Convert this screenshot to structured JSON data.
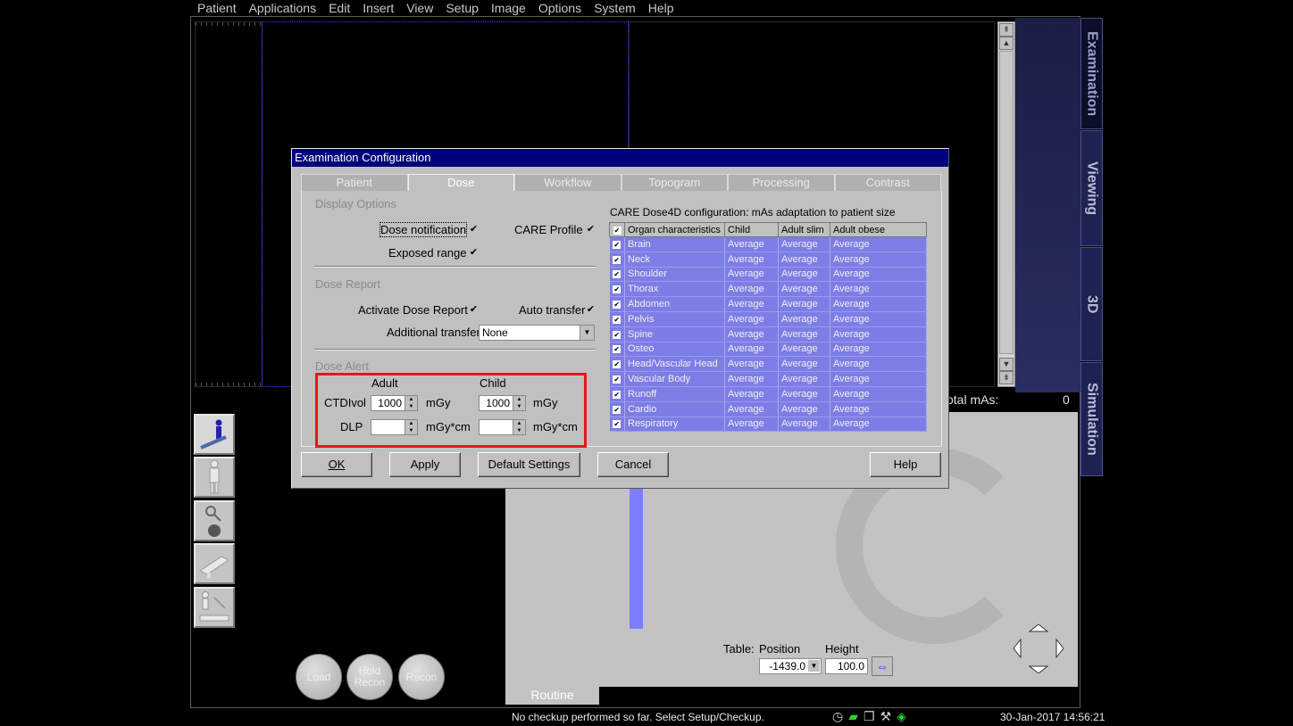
{
  "menu": [
    "Patient",
    "Applications",
    "Edit",
    "Insert",
    "View",
    "Setup",
    "Image",
    "Options",
    "System",
    "Help"
  ],
  "side_tabs": [
    "Examination",
    "Viewing",
    "3D",
    "Simulation"
  ],
  "round_buttons": {
    "load": "Load",
    "hold_recon_1": "Hold",
    "hold_recon_2": "Recon",
    "recon": "Recon"
  },
  "total_mas": {
    "label": "otal mAs:",
    "value": "0"
  },
  "routine_tab": "Routine",
  "table": {
    "label": "Table:",
    "position_label": "Position",
    "height_label": "Height",
    "position_value": "-1439.0",
    "height_value": "100.0"
  },
  "status": {
    "message": "No checkup performed so far. Select Setup/Checkup.",
    "datetime": "30-Jan-2017 14:56:21"
  },
  "dialog": {
    "title": "Examination Configuration",
    "tabs": [
      "Patient",
      "Dose",
      "Workflow",
      "Topogram",
      "Processing",
      "Contrast"
    ],
    "display_options": {
      "title": "Display Options",
      "dose_notification": "Dose notification",
      "care_profile": "CARE Profile",
      "exposed_range": "Exposed range"
    },
    "dose_report": {
      "title": "Dose Report",
      "activate": "Activate Dose Report",
      "auto_transfer": "Auto transfer",
      "additional_transfer": "Additional transfer",
      "additional_transfer_value": "None"
    },
    "dose_alert": {
      "title": "Dose Alert",
      "adult": "Adult",
      "child": "Child",
      "ctdivol": "CTDIvol",
      "dlp": "DLP",
      "ctdivol_adult": "1000",
      "ctdivol_child": "1000",
      "unit_mgy": "mGy",
      "unit_mgycm": "mGy*cm"
    },
    "care_dose": {
      "caption": "CARE Dose4D configuration: mAs adaptation to patient size",
      "headers": [
        "Organ characteristics",
        "Child",
        "Adult slim",
        "Adult obese"
      ],
      "rows": [
        [
          "Brain",
          "Average",
          "Average",
          "Average"
        ],
        [
          "Neck",
          "Average",
          "Average",
          "Average"
        ],
        [
          "Shoulder",
          "Average",
          "Average",
          "Average"
        ],
        [
          "Thorax",
          "Average",
          "Average",
          "Average"
        ],
        [
          "Abdomen",
          "Average",
          "Average",
          "Average"
        ],
        [
          "Pelvis",
          "Average",
          "Average",
          "Average"
        ],
        [
          "Spine",
          "Average",
          "Average",
          "Average"
        ],
        [
          "Osteo",
          "Average",
          "Average",
          "Average"
        ],
        [
          "Head/Vascular Head",
          "Average",
          "Average",
          "Average"
        ],
        [
          "Vascular Body",
          "Average",
          "Average",
          "Average"
        ],
        [
          "Runoff",
          "Average",
          "Average",
          "Average"
        ],
        [
          "Cardio",
          "Average",
          "Average",
          "Average"
        ],
        [
          "Respiratory",
          "Average",
          "Average",
          "Average"
        ]
      ]
    },
    "buttons": {
      "ok": "OK",
      "apply": "Apply",
      "default": "Default Settings",
      "cancel": "Cancel",
      "help": "Help"
    }
  }
}
